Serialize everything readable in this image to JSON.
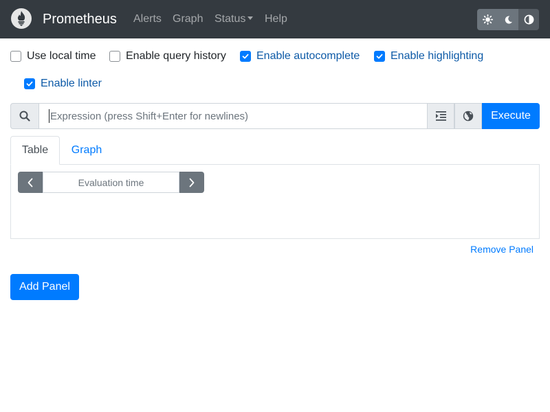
{
  "navbar": {
    "brand": "Prometheus",
    "links": {
      "alerts": "Alerts",
      "graph": "Graph",
      "status": "Status",
      "help": "Help"
    },
    "theme_buttons": [
      "sun-icon",
      "moon-icon",
      "half-circle-icon"
    ],
    "background_color": "#343a40"
  },
  "settings": {
    "use_local_time": {
      "label": "Use local time",
      "checked": false
    },
    "query_history": {
      "label": "Enable query history",
      "checked": false
    },
    "autocomplete": {
      "label": "Enable autocomplete",
      "checked": true
    },
    "highlighting": {
      "label": "Enable highlighting",
      "checked": true
    },
    "linter": {
      "label": "Enable linter",
      "checked": true
    }
  },
  "expression": {
    "placeholder": "Expression (press Shift+Enter for newlines)",
    "value": "",
    "execute_label": "Execute"
  },
  "panel": {
    "tabs": {
      "table": "Table",
      "graph": "Graph"
    },
    "active_tab": "Table",
    "evaluation_time_placeholder": "Evaluation time",
    "remove_label": "Remove Panel"
  },
  "add_panel_label": "Add Panel",
  "colors": {
    "primary": "#007bff",
    "secondary": "#6c757d",
    "checked_label": "#0d5aa7"
  }
}
